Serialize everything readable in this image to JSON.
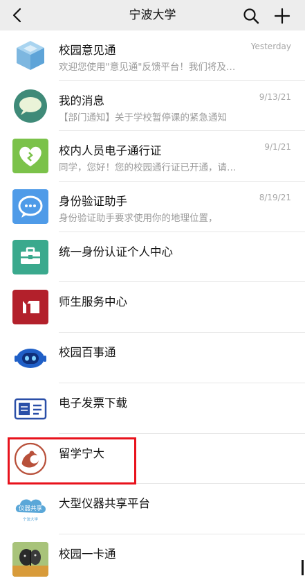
{
  "header": {
    "title": "宁波大学",
    "back_icon": "chevron-left-icon",
    "search_icon": "search-icon",
    "plus_icon": "plus-icon"
  },
  "chats": [
    {
      "id": "yijiantong",
      "name": "校园意见通",
      "preview": "欢迎您使用\"意见通\"反馈平台！我们将及…",
      "time": "Yesterday",
      "icon": "cube-icon",
      "color": "#8ec2e6"
    },
    {
      "id": "mymsg",
      "name": "我的消息",
      "preview": "【部门通知】关于学校暂停课的紧急通知",
      "time": "9/13/21",
      "icon": "speech-bubble-icon",
      "color": "#3f8a78"
    },
    {
      "id": "pass",
      "name": "校内人员电子通行证",
      "preview": "同学，您好！您的校园通行证已开通，请…",
      "time": "9/1/21",
      "icon": "heart-icon",
      "color": "#7bc24a"
    },
    {
      "id": "idauth",
      "name": "身份验证助手",
      "preview": "身份验证助手要求使用你的地理位置，",
      "time": "8/19/21",
      "icon": "chat-bubble-icon",
      "color": "#4f9be8"
    },
    {
      "id": "unified",
      "name": "统一身份认证个人中心",
      "preview": "",
      "time": "",
      "icon": "briefcase-icon",
      "color": "#3aa98d"
    },
    {
      "id": "service",
      "name": "师生服务中心",
      "preview": "",
      "time": "",
      "icon": "service-logo-icon",
      "color": "#b3202b"
    },
    {
      "id": "baishitong",
      "name": "校园百事通",
      "preview": "",
      "time": "",
      "icon": "robot-icon",
      "color": "#1f5fc7"
    },
    {
      "id": "invoice",
      "name": "电子发票下载",
      "preview": "",
      "time": "",
      "icon": "ticket-icon",
      "color": "#2a4fa8"
    },
    {
      "id": "studyabroad",
      "name": "留学宁大",
      "preview": "",
      "time": "",
      "icon": "swirl-logo-icon",
      "color": "#b8503a"
    },
    {
      "id": "instrument",
      "name": "大型仪器共享平台",
      "preview": "",
      "time": "",
      "icon": "cloud-logo-icon",
      "color": "#5aa7d8",
      "logo_text": "仪器共享",
      "logo_sub": "宁波大学"
    },
    {
      "id": "card",
      "name": "校园一卡通",
      "preview": "",
      "time": "",
      "icon": "butterfly-photo-icon",
      "color": "#6b8d3c"
    }
  ]
}
